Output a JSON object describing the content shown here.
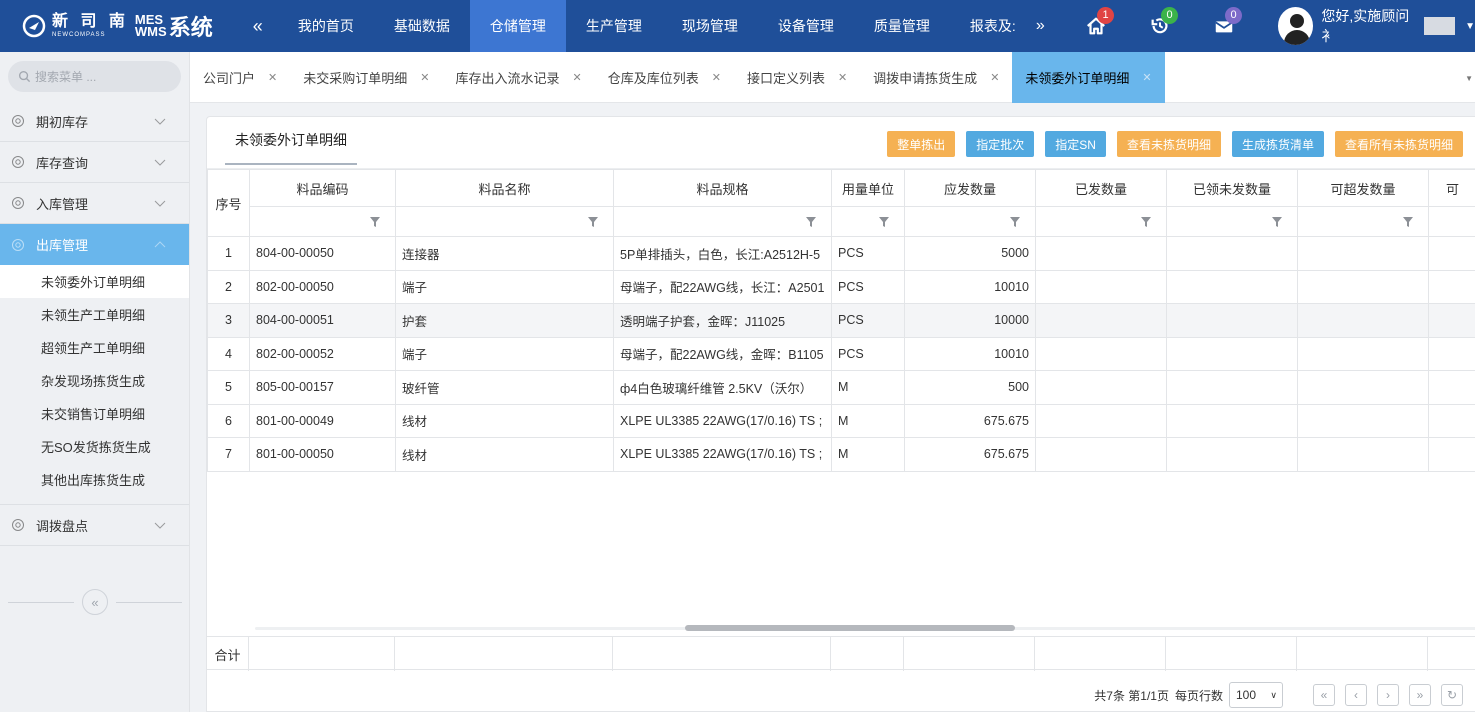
{
  "header": {
    "logo_cn": "新 司 南",
    "logo_en": "NEWCOMPASS",
    "logo_mes": "MES",
    "logo_wms": "WMS",
    "logo_sys": "系统",
    "collapse_glyph": "«",
    "nav": [
      {
        "label": "我的首页"
      },
      {
        "label": "基础数据"
      },
      {
        "label": "仓储管理",
        "active": true
      },
      {
        "label": "生产管理"
      },
      {
        "label": "现场管理"
      },
      {
        "label": "设备管理"
      },
      {
        "label": "质量管理"
      },
      {
        "label": "报表及:"
      }
    ],
    "more_glyph": "»",
    "badges": {
      "home": "1",
      "history": "0",
      "mail": "0"
    },
    "user_greeting": "您好,实施顾问 衤"
  },
  "sidebar": {
    "search_placeholder": "搜索菜单 ...",
    "groups": [
      {
        "label": "期初库存"
      },
      {
        "label": "库存查询"
      },
      {
        "label": "入库管理"
      },
      {
        "label": "出库管理",
        "active": true
      },
      {
        "label": "调拨盘点"
      }
    ],
    "subitems": [
      {
        "label": "未领委外订单明细",
        "active": true
      },
      {
        "label": "未领生产工单明细"
      },
      {
        "label": "超领生产工单明细"
      },
      {
        "label": "杂发现场拣货生成"
      },
      {
        "label": "未交销售订单明细"
      },
      {
        "label": "无SO发货拣货生成"
      },
      {
        "label": "其他出库拣货生成"
      }
    ],
    "collapse_glyph": "«"
  },
  "tabs": [
    {
      "label": "公司门户"
    },
    {
      "label": "未交采购订单明细"
    },
    {
      "label": "库存出入流水记录"
    },
    {
      "label": "仓库及库位列表"
    },
    {
      "label": "接口定义列表"
    },
    {
      "label": "调拨申请拣货生成"
    },
    {
      "label": "未领委外订单明细",
      "active": true
    }
  ],
  "panel": {
    "title": "未领委外订单明细",
    "actions": [
      {
        "label": "整单拣出",
        "color": "orange"
      },
      {
        "label": "指定批次",
        "color": "blue"
      },
      {
        "label": "指定SN",
        "color": "blue"
      },
      {
        "label": "查看未拣货明细",
        "color": "orange"
      },
      {
        "label": "生成拣货清单",
        "color": "blue"
      },
      {
        "label": "查看所有未拣货明细",
        "color": "orange"
      }
    ]
  },
  "table": {
    "seq_header": "序号",
    "columns": [
      "料品编码",
      "料品名称",
      "料品规格",
      "用量单位",
      "应发数量",
      "已发数量",
      "已领未发数量",
      "可超发数量",
      "可"
    ],
    "rows": [
      [
        "1",
        "804-00-00050",
        "连接器",
        "5P单排插头，白色，长江:A2512H-5",
        "PCS",
        "5000",
        "",
        "",
        "",
        ""
      ],
      [
        "2",
        "802-00-00050",
        "端子",
        "母端子，配22AWG线，长江：A2501",
        "PCS",
        "10010",
        "",
        "",
        "",
        ""
      ],
      [
        "3",
        "804-00-00051",
        "护套",
        "透明端子护套，金晖：J11025",
        "PCS",
        "10000",
        "",
        "",
        "",
        ""
      ],
      [
        "4",
        "802-00-00052",
        "端子",
        "母端子，配22AWG线，金晖：B1105",
        "PCS",
        "10010",
        "",
        "",
        "",
        ""
      ],
      [
        "5",
        "805-00-00157",
        "玻纤管",
        "ф4白色玻璃纤维管 2.5KV（沃尔）",
        "M",
        "500",
        "",
        "",
        "",
        ""
      ],
      [
        "6",
        "801-00-00049",
        "线材",
        "XLPE UL3385 22AWG(17/0.16) TS ;",
        "M",
        "675.675",
        "",
        "",
        "",
        ""
      ],
      [
        "7",
        "801-00-00050",
        "线材",
        "XLPE UL3385 22AWG(17/0.16) TS ;",
        "M",
        "675.675",
        "",
        "",
        "",
        ""
      ]
    ],
    "sum_label": "合计"
  },
  "pager": {
    "summary": "共7条 第1/1页",
    "per_page_label": "每页行数",
    "per_page_value": "100",
    "first": "«",
    "prev": "‹",
    "next": "›",
    "last": "»",
    "refresh": "↻"
  },
  "colors": {
    "topbar": "#1f4f99",
    "nav_active": "#3d76d2",
    "accent": "#69b6ec",
    "btn_orange": "#f5b153",
    "btn_blue": "#52a9e0"
  }
}
